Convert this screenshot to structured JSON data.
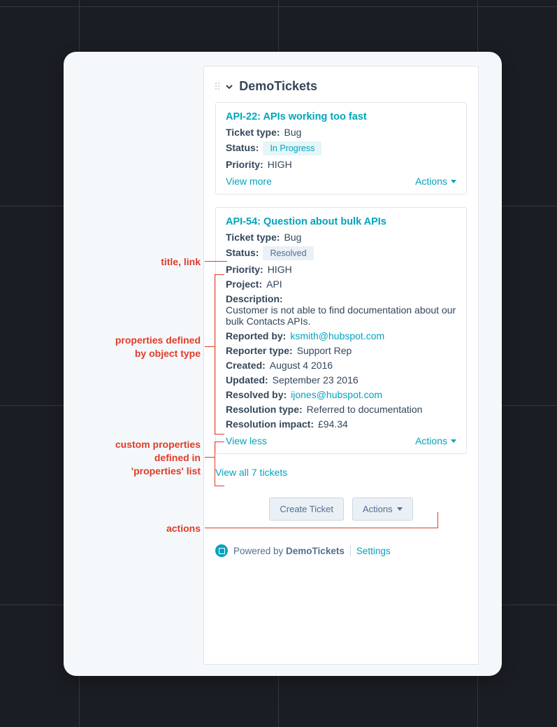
{
  "panel": {
    "title": "DemoTickets",
    "view_all": "View all 7 tickets"
  },
  "tickets": [
    {
      "title": "API-22: APIs working too fast",
      "rows": [
        {
          "label": "Ticket type:",
          "value": "Bug"
        },
        {
          "label": "Status:",
          "badge": "In Progress",
          "badge_class": "badge-progress"
        },
        {
          "label": "Priority:",
          "value": "HIGH"
        }
      ],
      "toggle": "View more",
      "actions": "Actions"
    },
    {
      "title": "API-54: Question about bulk APIs",
      "rows": [
        {
          "label": "Ticket type:",
          "value": "Bug"
        },
        {
          "label": "Status:",
          "badge": "Resolved",
          "badge_class": "badge-resolved"
        },
        {
          "label": "Priority:",
          "value": "HIGH"
        },
        {
          "label": "Project:",
          "value": "API"
        },
        {
          "label": "Description:",
          "value": "Customer is not able to find documentation about our bulk Contacts APIs."
        },
        {
          "label": "Reported by:",
          "link": "ksmith@hubspot.com"
        },
        {
          "label": "Reporter type:",
          "value": "Support Rep"
        },
        {
          "label": "Created:",
          "value": "August 4 2016"
        },
        {
          "label": "Updated:",
          "value": "September 23 2016"
        },
        {
          "label": "Resolved by:",
          "link": "ijones@hubspot.com"
        },
        {
          "label": "Resolution type:",
          "value": "Referred to documentation"
        },
        {
          "label": "Resolution impact:",
          "value": "£94.34"
        }
      ],
      "toggle": "View less",
      "actions": "Actions"
    }
  ],
  "buttons": {
    "create": "Create Ticket",
    "actions": "Actions"
  },
  "footer": {
    "powered_prefix": "Powered by ",
    "powered_brand": "DemoTickets",
    "settings": "Settings"
  },
  "annotations": {
    "title_link": "title, link",
    "props_object": "properties defined\nby object type",
    "props_custom": "custom properties\ndefined in\n'properties' list",
    "actions": "actions"
  }
}
